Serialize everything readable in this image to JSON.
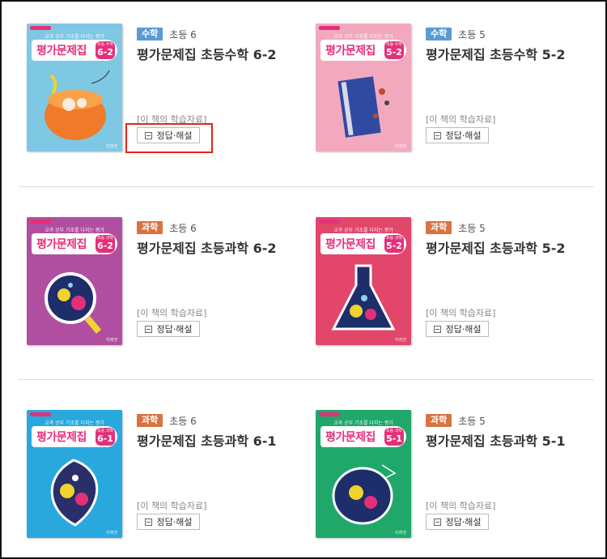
{
  "materials_label": "[이 책의 학습자료]",
  "answer_label": "정답·해설",
  "cover_tagline": "교과 공부 기초를 다지는 평가",
  "publisher": "미래엔",
  "books": [
    {
      "subject": "수학",
      "subject_color": "#5b9bd5",
      "grade": "초등 6",
      "title": "평가문제집 초등수학 6-2",
      "cover_title": "평가문제집",
      "cover_sub": "초등 수학",
      "cover_grade": "6-2",
      "cover_bg": "#7ec8e3",
      "accent": "#e4307a",
      "art": "math-cup"
    },
    {
      "subject": "수학",
      "subject_color": "#5b9bd5",
      "grade": "초등 5",
      "title": "평가문제집 초등수학 5-2",
      "cover_title": "평가문제집",
      "cover_sub": "초등 수학",
      "cover_grade": "5-2",
      "cover_bg": "#f2a9bd",
      "accent": "#e4307a",
      "art": "math-book"
    },
    {
      "subject": "과학",
      "subject_color": "#d9733f",
      "grade": "초등 6",
      "title": "평가문제집 초등과학 6-2",
      "cover_title": "평가문제집",
      "cover_sub": "초등 과학",
      "cover_grade": "6-2",
      "cover_bg": "#b04fa0",
      "accent": "#e4307a",
      "art": "sci-magnifier"
    },
    {
      "subject": "과학",
      "subject_color": "#d9733f",
      "grade": "초등 5",
      "title": "평가문제집 초등과학 5-2",
      "cover_title": "평가문제집",
      "cover_sub": "초등 과학",
      "cover_grade": "5-2",
      "cover_bg": "#e2466b",
      "accent": "#e4307a",
      "art": "sci-flask"
    },
    {
      "subject": "과학",
      "subject_color": "#d9733f",
      "grade": "초등 6",
      "title": "평가문제집 초등과학 6-1",
      "cover_title": "평가문제집",
      "cover_sub": "초등 과학",
      "cover_grade": "6-1",
      "cover_bg": "#29a8dd",
      "accent": "#e4307a",
      "art": "sci-leaf"
    },
    {
      "subject": "과학",
      "subject_color": "#d9733f",
      "grade": "초등 5",
      "title": "평가문제집 초등과학 5-1",
      "cover_title": "평가문제집",
      "cover_sub": "초등 과학",
      "cover_grade": "5-1",
      "cover_bg": "#1fa86a",
      "accent": "#e4307a",
      "art": "sci-planet"
    }
  ]
}
